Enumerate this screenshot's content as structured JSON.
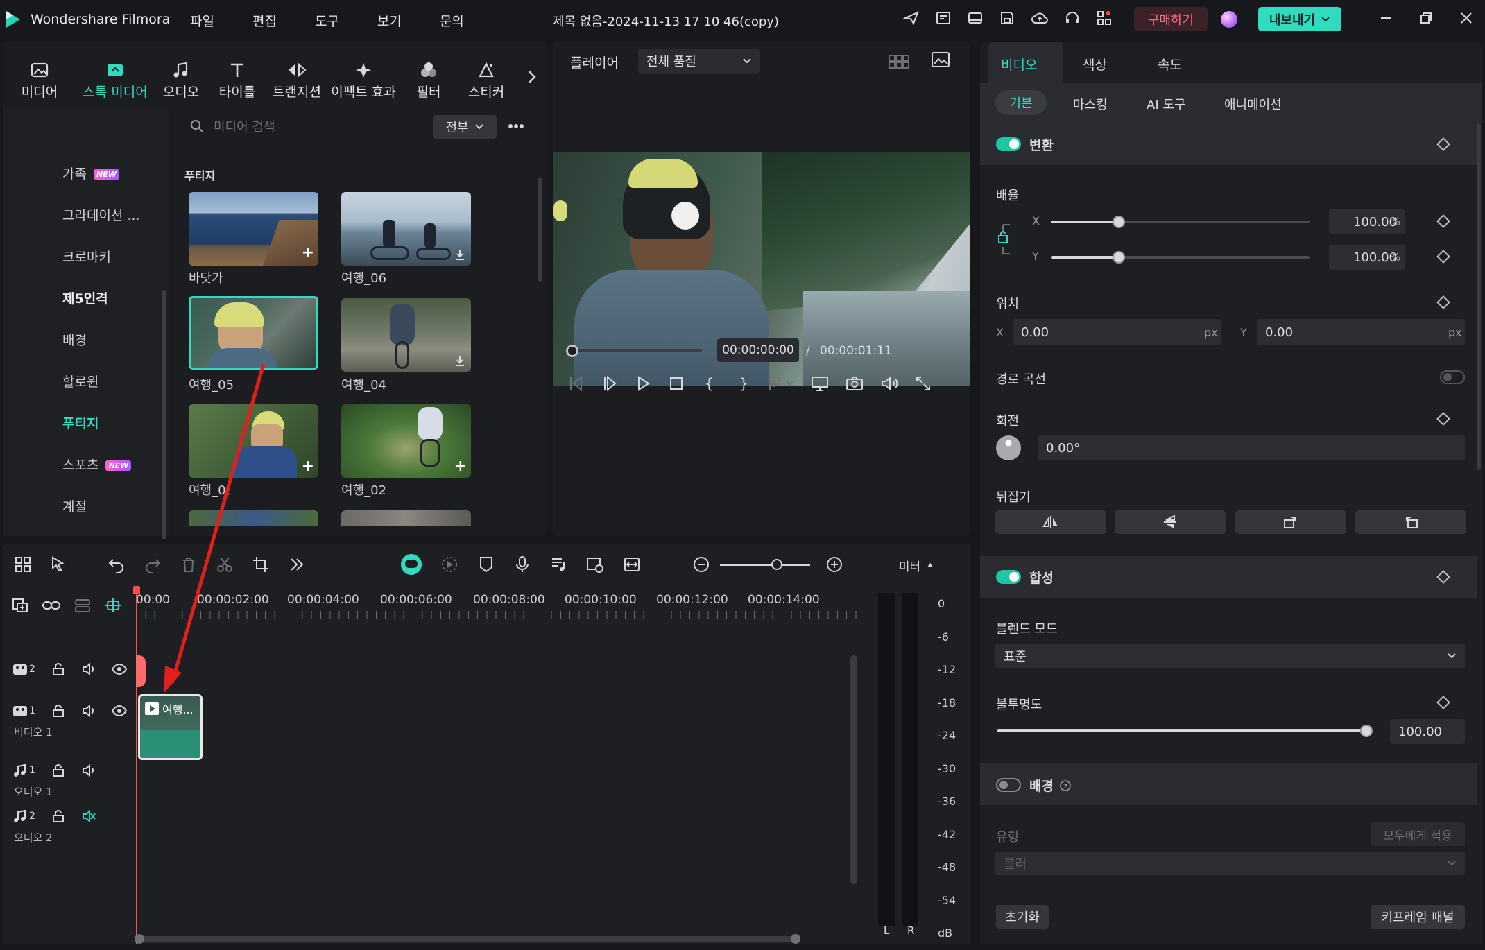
{
  "app": {
    "name": "Wondershare Filmora",
    "title": "제목 없음-2024-11-13 17 10 46(copy)"
  },
  "menu": [
    "파일",
    "편집",
    "도구",
    "보기",
    "문의"
  ],
  "header": {
    "buy_label": "구매하기",
    "export_label": "내보내기"
  },
  "media_toolbar": [
    {
      "label": "미디어",
      "icon": "media-icon"
    },
    {
      "label": "스톡 미디어",
      "icon": "stock-media-icon",
      "active": true
    },
    {
      "label": "오디오",
      "icon": "music-note-icon"
    },
    {
      "label": "타이틀",
      "icon": "title-t-icon"
    },
    {
      "label": "트랜지션",
      "icon": "transition-icon"
    },
    {
      "label": "이펙트 효과",
      "icon": "effects-sparkle-icon"
    },
    {
      "label": "필터",
      "icon": "filter-icon"
    },
    {
      "label": "스티커",
      "icon": "sticker-icon"
    }
  ],
  "categories": [
    {
      "label": "가족",
      "badge": "NEW"
    },
    {
      "label": "그라데이션 ..."
    },
    {
      "label": "크로마키"
    },
    {
      "label": "제5인격",
      "bold": true
    },
    {
      "label": "배경"
    },
    {
      "label": "할로윈"
    },
    {
      "label": "푸티지",
      "active": true
    },
    {
      "label": "스포츠",
      "badge": "NEW"
    },
    {
      "label": "계절"
    }
  ],
  "search": {
    "placeholder": "미디어 검색",
    "filter": "전부"
  },
  "media": {
    "section_title": "푸티지",
    "items": [
      {
        "label": "바닷가"
      },
      {
        "label": "여행_06"
      },
      {
        "label": "여행_05",
        "selected": true
      },
      {
        "label": "여행_04"
      },
      {
        "label": "여행_03"
      },
      {
        "label": "여행_02"
      }
    ]
  },
  "player": {
    "label": "플레이어",
    "quality": "전체 품질",
    "current_time": "00:00:00:00",
    "separator": "/",
    "total_time": "00:00:01:11"
  },
  "timeline": {
    "ruler": [
      "00:00",
      "00:00:02:00",
      "00:00:04:00",
      "00:00:06:00",
      "00:00:08:00",
      "00:00:10:00",
      "00:00:12:00",
      "00:00:14:00"
    ],
    "meter_label": "미터",
    "meter_scale": [
      "0",
      "-6",
      "-12",
      "-18",
      "-24",
      "-30",
      "-36",
      "-42",
      "-48",
      "-54",
      "dB"
    ],
    "meter_channels": [
      "L",
      "R"
    ],
    "tracks": [
      {
        "num": "2",
        "name": ""
      },
      {
        "num": "1",
        "name": "비디오 1"
      },
      {
        "num": "1",
        "name": "오디오 1"
      },
      {
        "num": "2",
        "name": "오디오 2"
      }
    ],
    "clip_label": "여행..."
  },
  "inspector": {
    "tabs": [
      "비디오",
      "색상",
      "속도"
    ],
    "subtabs": [
      "기본",
      "마스킹",
      "AI 도구",
      "애니메이션"
    ],
    "transform": {
      "title": "변환",
      "scale_label": "배율",
      "x_label": "X",
      "y_label": "Y",
      "scale_x": "100.00",
      "scale_y": "100.00",
      "percent": "%",
      "scale_x_level": 0.26,
      "scale_y_level": 0.26,
      "position_label": "위치",
      "pos_x": "0.00",
      "pos_y": "0.00",
      "px": "px",
      "path_curve": "경로 곡선",
      "rotation_label": "회전",
      "rotation": "0.00°",
      "flip_label": "뒤집기"
    },
    "compositing": {
      "title": "합성",
      "blend_label": "블렌드 모드",
      "blend_value": "표준",
      "opacity_label": "불투명도",
      "opacity": "100.00",
      "opacity_level": 1.0
    },
    "background": {
      "title": "배경",
      "type_label": "유형",
      "apply_all": "모두에게 적용",
      "type_value": "블러"
    },
    "reset_label": "초기화",
    "keyframe_label": "키프레임 패널"
  },
  "colors": {
    "accent": "#1ec6a4",
    "buy": "#ff5a7a",
    "export": "#2fdcc0",
    "playhead": "#ff4d4d",
    "annotation": "#e0201c"
  }
}
